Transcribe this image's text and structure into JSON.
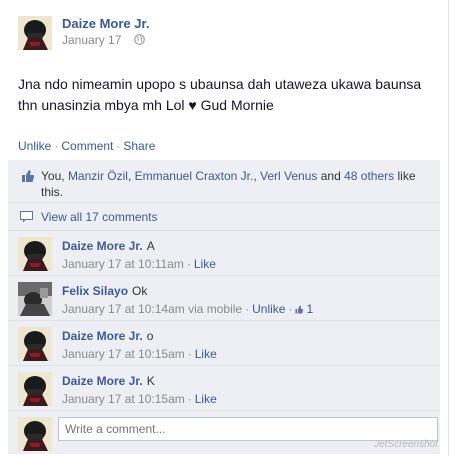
{
  "post": {
    "author": "Daize More Jr.",
    "date": "January 17",
    "privacy_icon": "globe-icon",
    "text": "Jna ndo nimeamin upopo s ubaunsa dah utaweza ukawa baunsa thn unasinzia mbya mh Lol ♥ Gud Mornie",
    "actions": {
      "unlike": "Unlike",
      "comment": "Comment",
      "share": "Share"
    }
  },
  "likes": {
    "icon": "thumbs-up-icon",
    "prefix": "You,",
    "people": [
      "Manzir Özil",
      "Emmanuel Craxton Jr.",
      "Verl Venus"
    ],
    "and": "and",
    "others": "48 others",
    "suffix": "like this."
  },
  "view_all": {
    "icon": "comment-bubble-icon",
    "label": "View all 17 comments"
  },
  "comments": [
    {
      "author": "Daize More Jr.",
      "text": "A",
      "time": "January 17 at 10:11am",
      "like": "Like"
    },
    {
      "author": "Felix Silayo",
      "text": "Ok",
      "time": "January 17 at 10:14am via mobile",
      "like": "Unlike",
      "like_count": "1"
    },
    {
      "author": "Daize More Jr.",
      "text": "o",
      "time": "January 17 at 10:15am",
      "like": "Like"
    },
    {
      "author": "Daize More Jr.",
      "text": "K",
      "time": "January 17 at 10:15am",
      "like": "Like"
    }
  ],
  "write_comment": {
    "placeholder": "Write a comment..."
  },
  "watermark": "JetScreenshot",
  "colors": {
    "link": "#3b5998",
    "ufi_bg": "#edeff4",
    "meta": "#8a8a8a"
  }
}
